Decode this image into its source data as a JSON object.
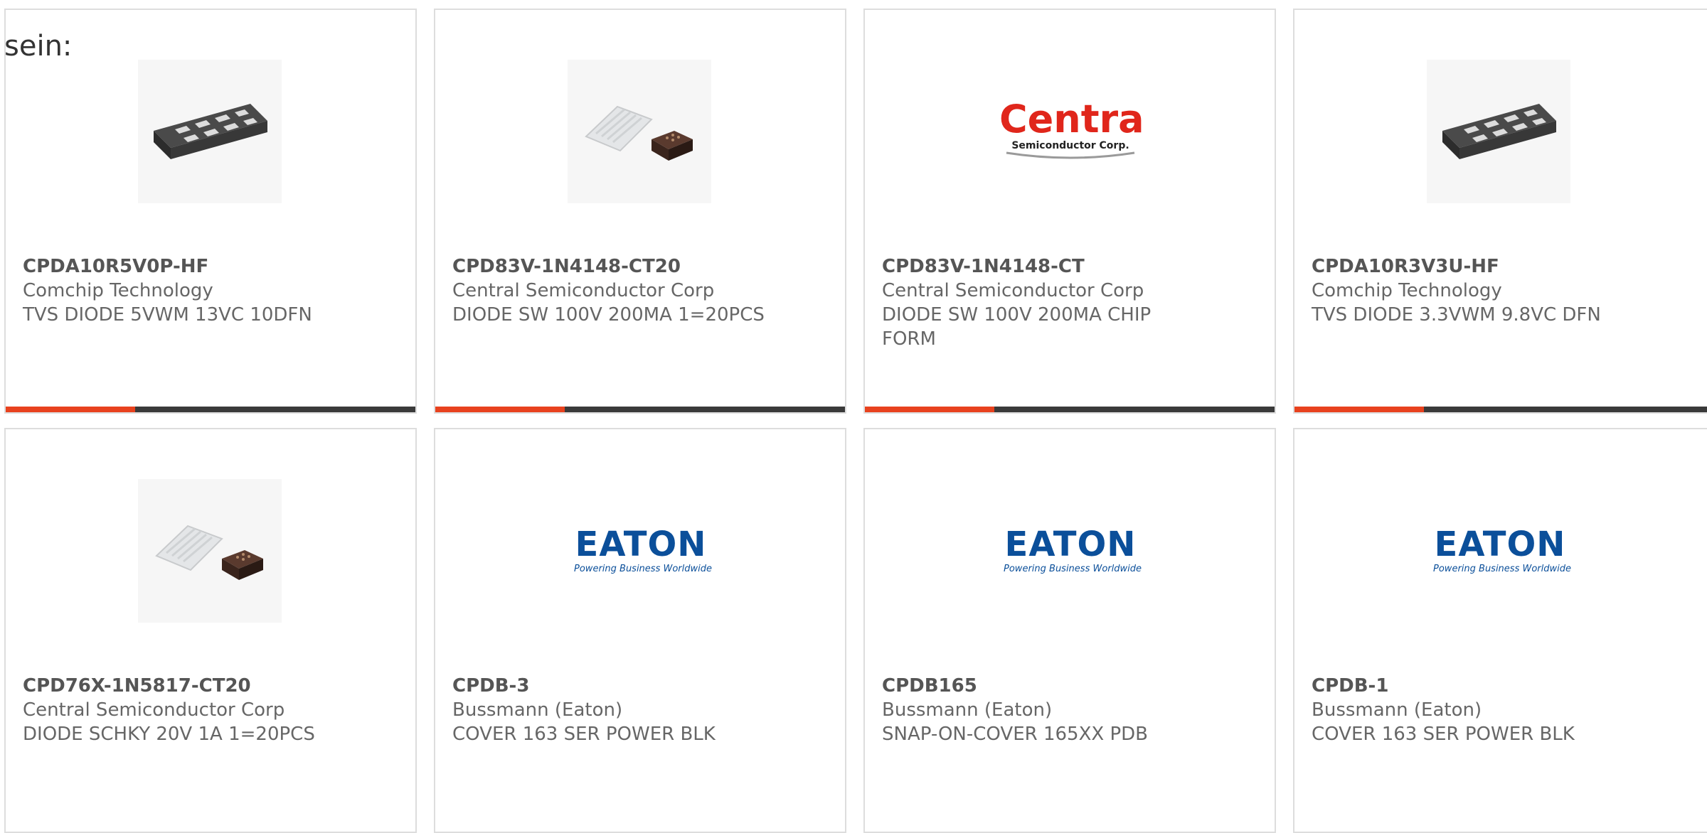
{
  "intro_text": "sein:",
  "colors": {
    "accent_orange": "#e8421e",
    "accent_dark": "#3a3a3a",
    "eaton_blue": "#0b4f9a",
    "central_red": "#e0261b"
  },
  "products": [
    {
      "part_number": "CPDA10R5V0P-HF",
      "manufacturer": "Comchip Technology",
      "description": "TVS DIODE 5VWM 13VC 10DFN",
      "image": "dfn-package-chip-image"
    },
    {
      "part_number": "CPD83V-1N4148-CT20",
      "manufacturer": "Central Semiconductor Corp",
      "description": "DIODE SW 100V 200MA 1=20PCS",
      "image": "bare-die-chip-image"
    },
    {
      "part_number": "CPD83V-1N4148-CT",
      "manufacturer": "Central Semiconductor Corp",
      "description": "DIODE SW 100V 200MA CHIP FORM",
      "image": "central-logo",
      "logo_text": "Central",
      "logo_sub": "Semiconductor Corp."
    },
    {
      "part_number": "CPDA10R3V3U-HF",
      "manufacturer": "Comchip Technology",
      "description": "TVS DIODE 3.3VWM 9.8VC DFN",
      "image": "dfn-package-chip-image"
    },
    {
      "part_number": "CPD76X-1N5817-CT20",
      "manufacturer": "Central Semiconductor Corp",
      "description": "DIODE SCHKY 20V 1A 1=20PCS",
      "image": "bare-die-chip-image"
    },
    {
      "part_number": "CPDB-3",
      "manufacturer": "Bussmann (Eaton)",
      "description": "COVER 163 SER POWER BLK",
      "image": "eaton-logo",
      "logo_text": "EATON",
      "logo_sub": "Powering Business Worldwide"
    },
    {
      "part_number": "CPDB165",
      "manufacturer": "Bussmann (Eaton)",
      "description": "SNAP-ON-COVER 165XX PDB",
      "image": "eaton-logo",
      "logo_text": "EATON",
      "logo_sub": "Powering Business Worldwide"
    },
    {
      "part_number": "CPDB-1",
      "manufacturer": "Bussmann (Eaton)",
      "description": "COVER 163 SER POWER BLK",
      "image": "eaton-logo",
      "logo_text": "EATON",
      "logo_sub": "Powering Business Worldwide"
    }
  ]
}
